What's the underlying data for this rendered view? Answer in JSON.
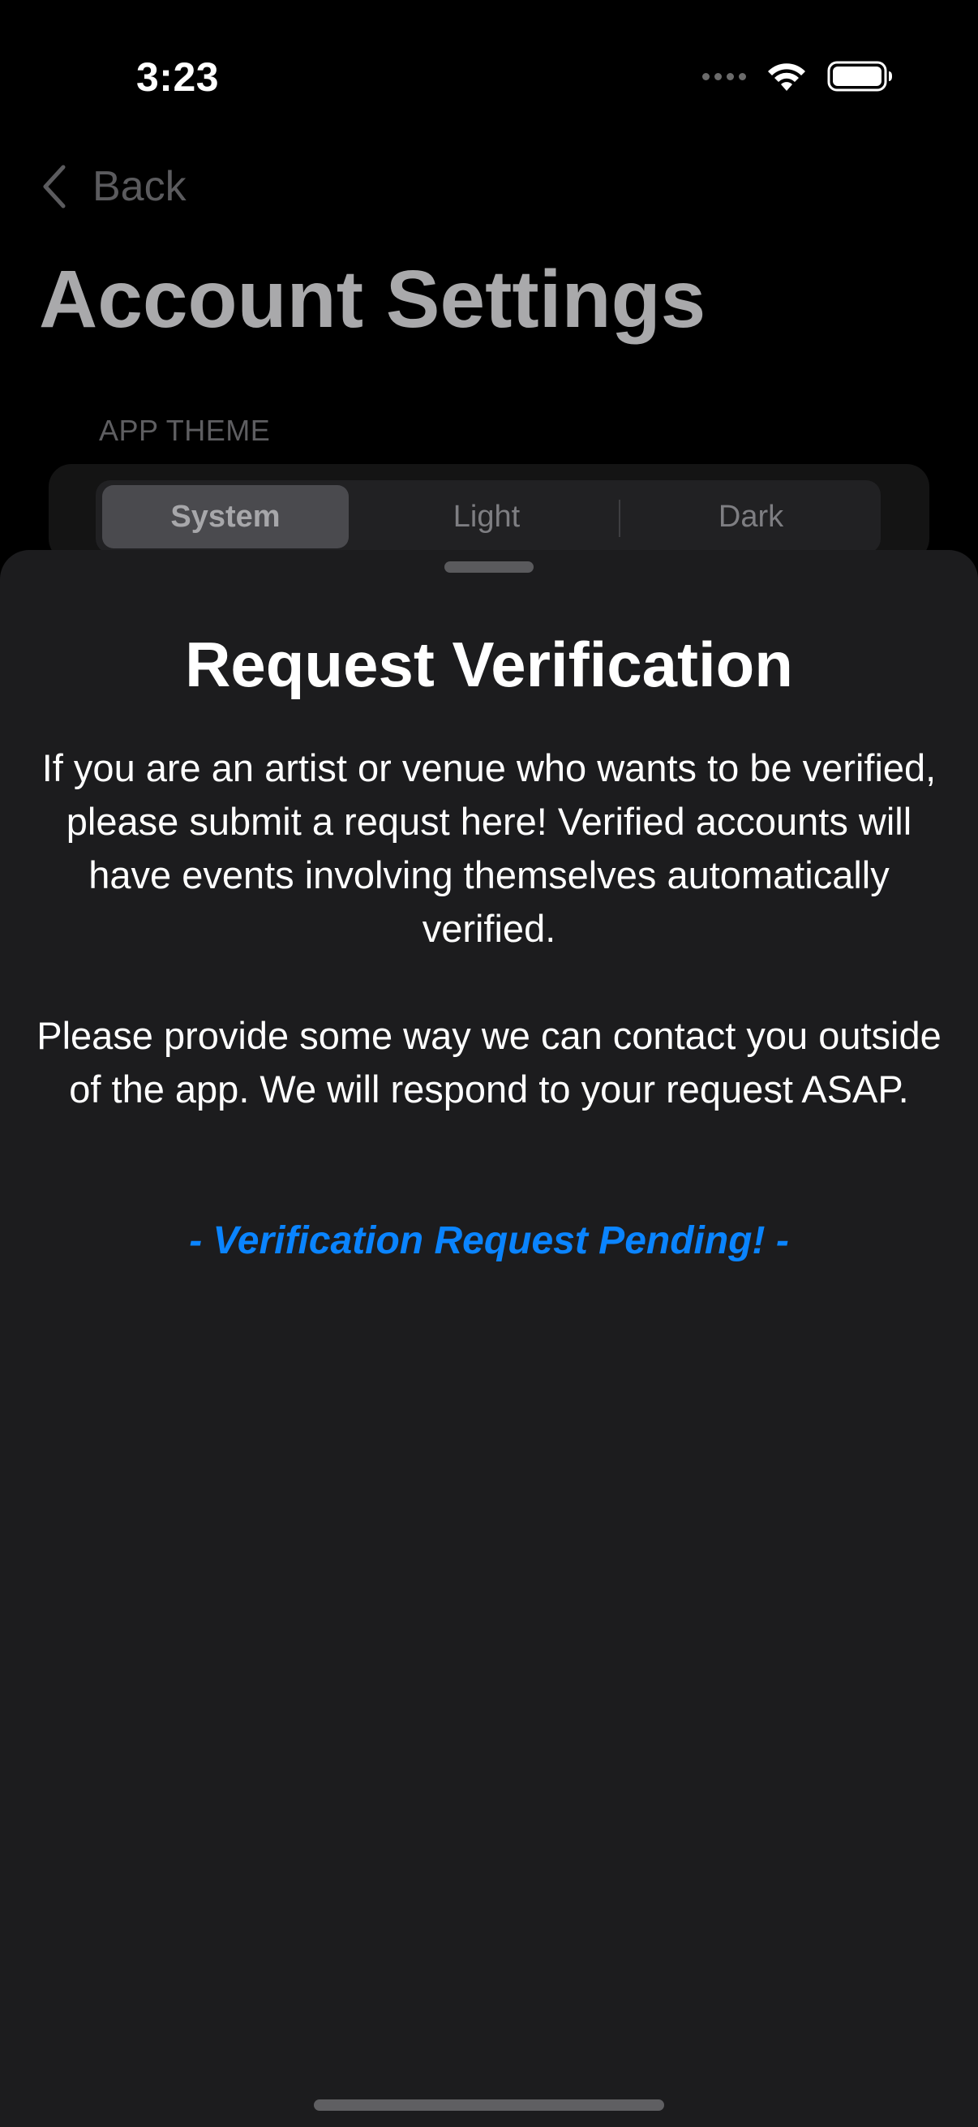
{
  "status_bar": {
    "time": "3:23"
  },
  "nav": {
    "back_label": "Back"
  },
  "page": {
    "title": "Account Settings"
  },
  "theme_section": {
    "label": "APP THEME",
    "options": [
      "System",
      "Light",
      "Dark"
    ],
    "selected": "System"
  },
  "sheet": {
    "title": "Request Verification",
    "paragraph_1": "If you are an artist or venue who wants to be verified, please submit a requst here! Verified accounts will have events involving themselves automatically verified.",
    "paragraph_2": "Please provide some way we can contact you outside of the app. We will respond to your request ASAP.",
    "status_text": "- Verification Request Pending! -"
  },
  "colors": {
    "accent": "#0a84ff",
    "sheet_background": "#1c1c1e",
    "page_background": "#000000"
  },
  "icons": [
    "cellular-signal-icon",
    "wifi-icon",
    "battery-icon",
    "chevron-left-icon"
  ]
}
